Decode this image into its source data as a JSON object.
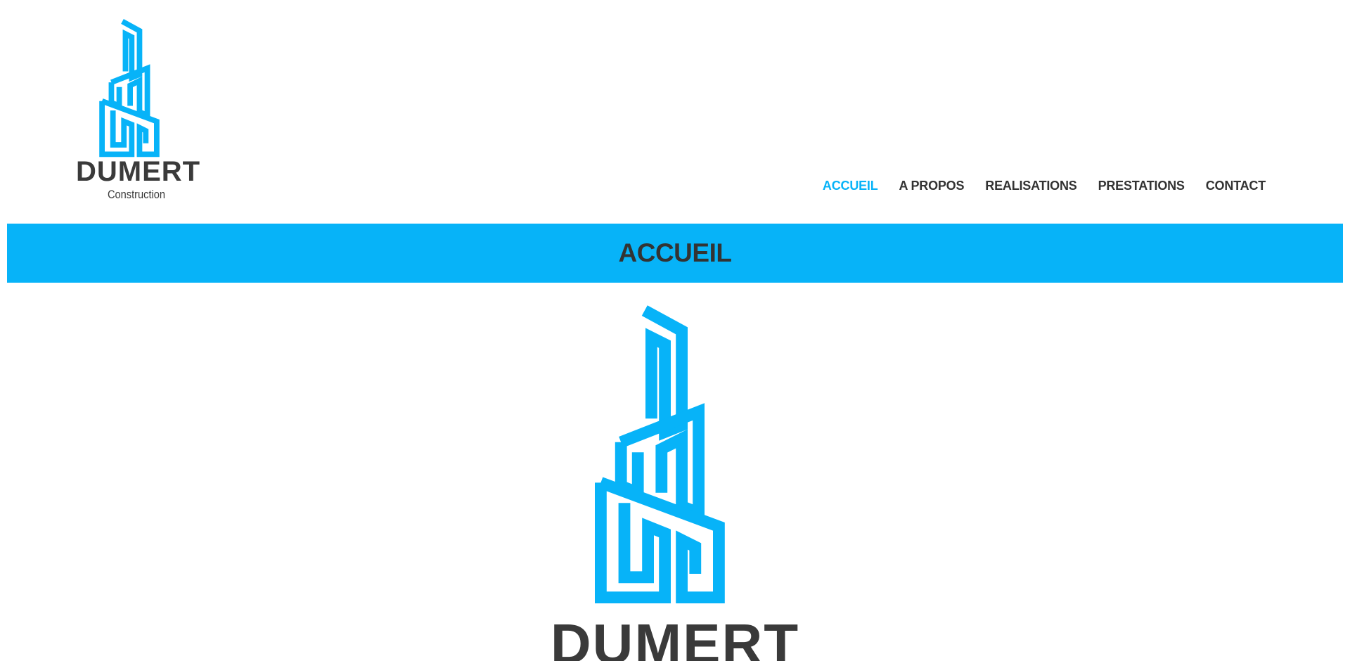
{
  "brand": {
    "name": "DUMERT",
    "tagline": "Construction",
    "color": "#07b3f8",
    "text_color": "#3a3a3a"
  },
  "nav": {
    "items": [
      {
        "label": "ACCUEIL",
        "active": true
      },
      {
        "label": "A PROPOS",
        "active": false
      },
      {
        "label": "REALISATIONS",
        "active": false
      },
      {
        "label": "PRESTATIONS",
        "active": false
      },
      {
        "label": "CONTACT",
        "active": false
      }
    ]
  },
  "banner": {
    "title": "ACCUEIL",
    "background": "#07b3f8"
  },
  "hero": {
    "word": "DUMERT"
  }
}
